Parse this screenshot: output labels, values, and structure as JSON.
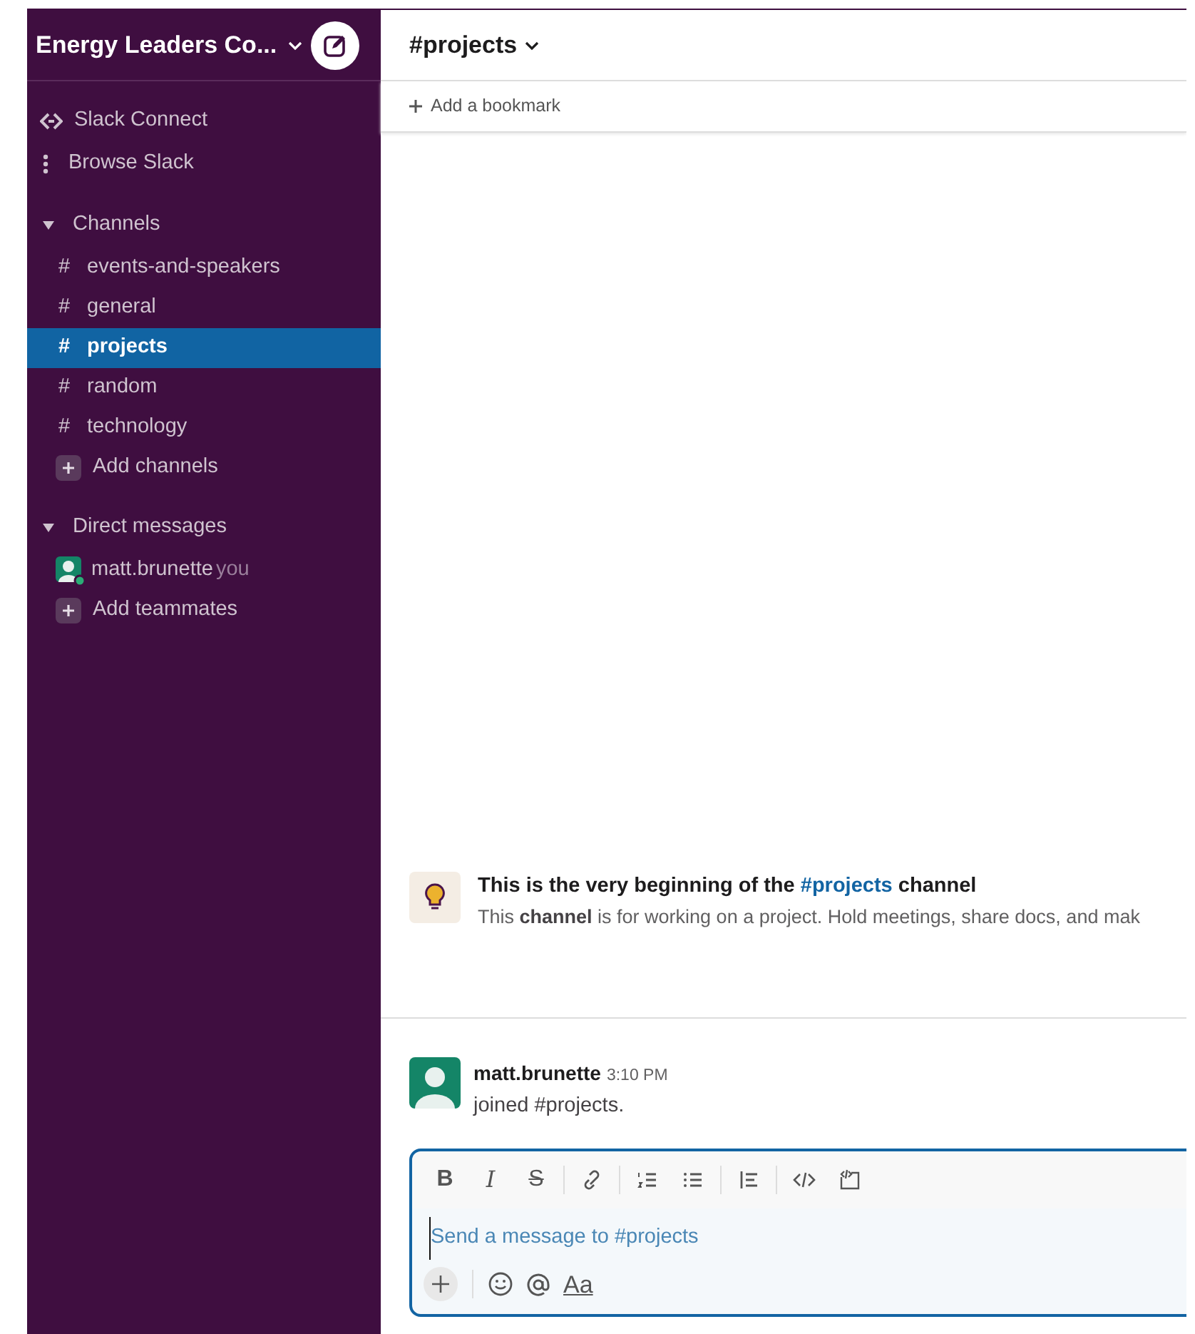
{
  "workspace": {
    "name": "Energy Leaders Co..."
  },
  "sidebar": {
    "top_items": [
      {
        "kind": "connect",
        "label": "Slack Connect"
      },
      {
        "kind": "browse",
        "label": "Browse Slack"
      }
    ],
    "sections": [
      {
        "title": "Channels",
        "expanded": true,
        "items": [
          {
            "kind": "channel",
            "prefix": "#",
            "label": "events-and-speakers",
            "selected": false
          },
          {
            "kind": "channel",
            "prefix": "#",
            "label": "general",
            "selected": false
          },
          {
            "kind": "channel",
            "prefix": "#",
            "label": "projects",
            "selected": true
          },
          {
            "kind": "channel",
            "prefix": "#",
            "label": "random",
            "selected": false
          },
          {
            "kind": "channel",
            "prefix": "#",
            "label": "technology",
            "selected": false
          },
          {
            "kind": "add",
            "label": "Add channels",
            "selected": false
          }
        ]
      },
      {
        "title": "Direct messages",
        "expanded": true,
        "items": [
          {
            "kind": "user",
            "label": "matt.brunette",
            "suffix": "you",
            "online": true,
            "selected": false
          },
          {
            "kind": "add",
            "label": "Add teammates",
            "selected": false
          }
        ]
      }
    ]
  },
  "channel_header": {
    "prefix": "#",
    "name": "projects",
    "bookmark": "Add a bookmark"
  },
  "intro": {
    "before": "This is the very beginning of the",
    "link": "#projects",
    "after": "channel",
    "description": "This **channel** is for working on a project. Hold meetings, share docs, and mak"
  },
  "messages": [
    {
      "author": "matt.brunette",
      "time": "3:10 PM",
      "text": "joined #projects."
    }
  ],
  "composer": {
    "format_buttons": [
      {
        "kind": "bold",
        "label": "B"
      },
      {
        "kind": "italic",
        "label": "I"
      },
      {
        "kind": "strike",
        "label": "S"
      },
      {
        "kind": "sep"
      },
      {
        "kind": "link"
      },
      {
        "kind": "sep"
      },
      {
        "kind": "olist"
      },
      {
        "kind": "ulist"
      },
      {
        "kind": "sep"
      },
      {
        "kind": "quote"
      },
      {
        "kind": "sep"
      },
      {
        "kind": "code"
      },
      {
        "kind": "codeblock"
      }
    ],
    "placeholder": "Send a message to #projects",
    "text_button": "Aa"
  }
}
